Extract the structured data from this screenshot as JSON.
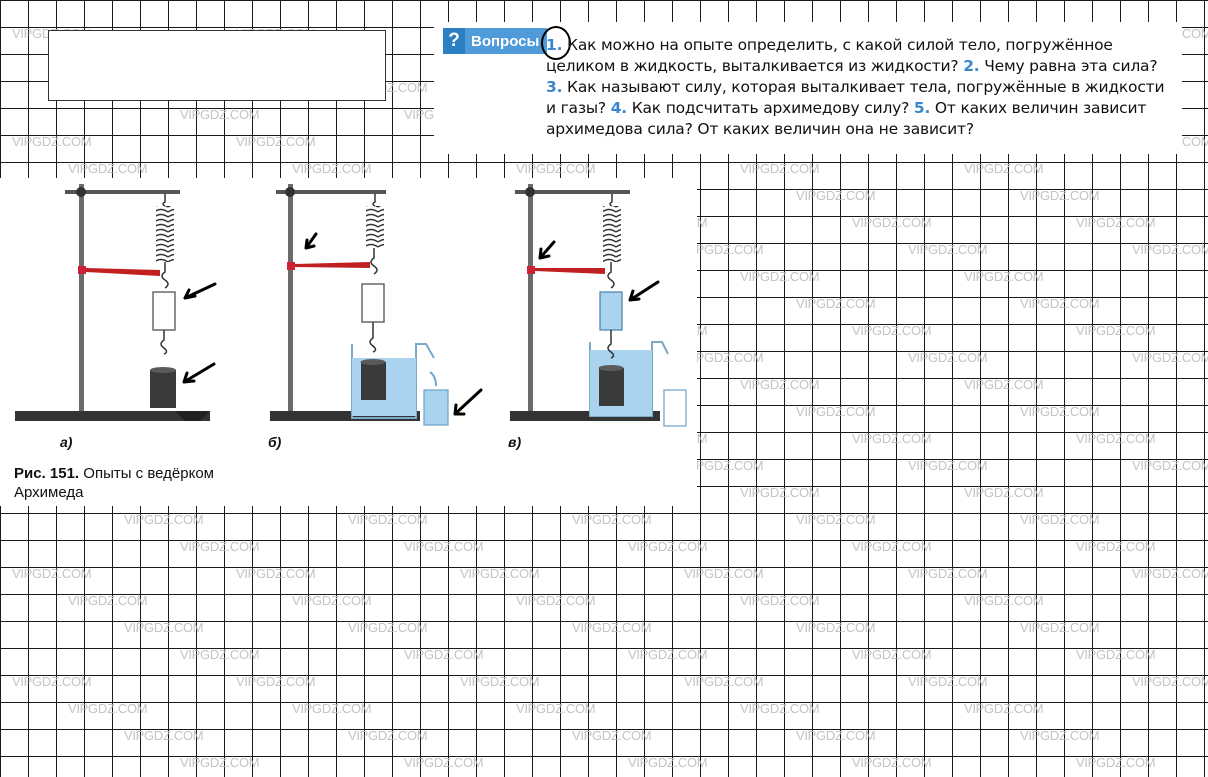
{
  "questions": {
    "badge": "Вопросы",
    "badge_icon": "question-mark-icon",
    "badge_color": "#2d7fc4",
    "items": [
      {
        "num": "1.",
        "text": "Как можно на опыте определить, с какой силой тело, погружённое целиком в жидкость, выталкивается из жидкости?"
      },
      {
        "num": "2.",
        "text": "Чему равна эта сила?"
      },
      {
        "num": "3.",
        "text": "Как называют силу, которая выталкивает тела, погружён­ные в жидкости и газы?"
      },
      {
        "num": "4.",
        "text": "Как подсчитать архимедову силу?"
      },
      {
        "num": "5.",
        "text": "От ка­ких величин зависит архимедова сила? От каких величин она не за­висит?"
      }
    ]
  },
  "figure": {
    "labels": [
      "а)",
      "б)",
      "в)"
    ],
    "caption_num": "Рис. 151.",
    "caption_text": "Опыты с ведёрком Архимеда",
    "water_color": "#a9d3ef"
  },
  "watermark": "VIPGDZ.COM"
}
